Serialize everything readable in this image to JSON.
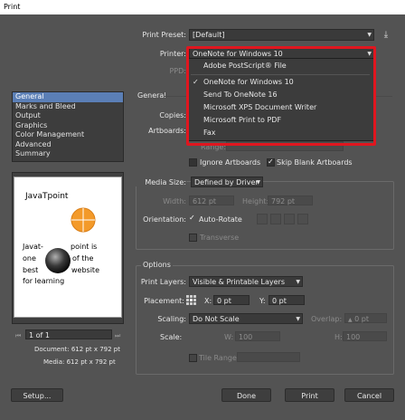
{
  "window": {
    "title": "Print"
  },
  "header": {
    "preset_label": "Print Preset:",
    "preset_value": "[Default]",
    "printer_label": "Printer:",
    "printer_value": "OneNote for Windows 10",
    "ppd_label": "PPD:"
  },
  "printer_menu": {
    "items": [
      {
        "label": "Adobe PostScript® File",
        "checked": false
      },
      {
        "label": "OneNote for Windows 10",
        "checked": true
      },
      {
        "label": "Send To OneNote 16",
        "checked": false
      },
      {
        "label": "Microsoft XPS Document Writer",
        "checked": false
      },
      {
        "label": "Microsoft Print to PDF",
        "checked": false
      },
      {
        "label": "Fax",
        "checked": false
      }
    ],
    "check_glyph": "✓",
    "highlight_color": "#e0161f"
  },
  "sidebar": {
    "items": [
      {
        "label": "General"
      },
      {
        "label": "Marks and Bleed"
      },
      {
        "label": "Output"
      },
      {
        "label": "Graphics"
      },
      {
        "label": "Color Management"
      },
      {
        "label": "Advanced"
      },
      {
        "label": "Summary"
      }
    ],
    "selected_index": 0
  },
  "general": {
    "section_label": "General",
    "copies_label": "Copies:",
    "artboards_label": "Artboards:",
    "range_label": "Range:",
    "ignore_artboards_label": "Ignore Artboards",
    "skip_blank_label": "Skip Blank Artboards",
    "skip_blank_checked": true
  },
  "media": {
    "size_label": "Media Size:",
    "size_value": "Defined by Driver",
    "width_label": "Width:",
    "width_value": "612 pt",
    "height_label": "Height:",
    "height_value": "792 pt",
    "orientation_label": "Orientation:",
    "auto_rotate_label": "Auto-Rotate",
    "auto_rotate_checked": true,
    "transverse_label": "Transverse"
  },
  "options": {
    "section_label": "Options",
    "print_layers_label": "Print Layers:",
    "print_layers_value": "Visible & Printable Layers",
    "placement_label": "Placement:",
    "x_label": "X:",
    "x_value": "0 pt",
    "y_label": "Y:",
    "y_value": "0 pt",
    "scaling_label": "Scaling:",
    "scaling_value": "Do Not Scale",
    "overlap_label": "Overlap:",
    "overlap_value": "0 pt",
    "scale_label": "Scale:",
    "w_label": "W:",
    "w_value": "100",
    "h_label": "H:",
    "h_value": "100",
    "tile_range_label": "Tile Range:"
  },
  "preview": {
    "page_title": "JavaTpoint",
    "left_lines": [
      "Javat-",
      "one",
      "best",
      "for learning"
    ],
    "right_lines": [
      "point is",
      "of the",
      "website"
    ],
    "nav_value": "1 of 1",
    "document_line": "Document: 612 pt x 792 pt",
    "media_line": "Media: 612 pt x 792 pt",
    "orange_color": "#f39a2a"
  },
  "footer": {
    "setup_label": "Setup...",
    "done_label": "Done",
    "print_label": "Print",
    "cancel_label": "Cancel"
  }
}
